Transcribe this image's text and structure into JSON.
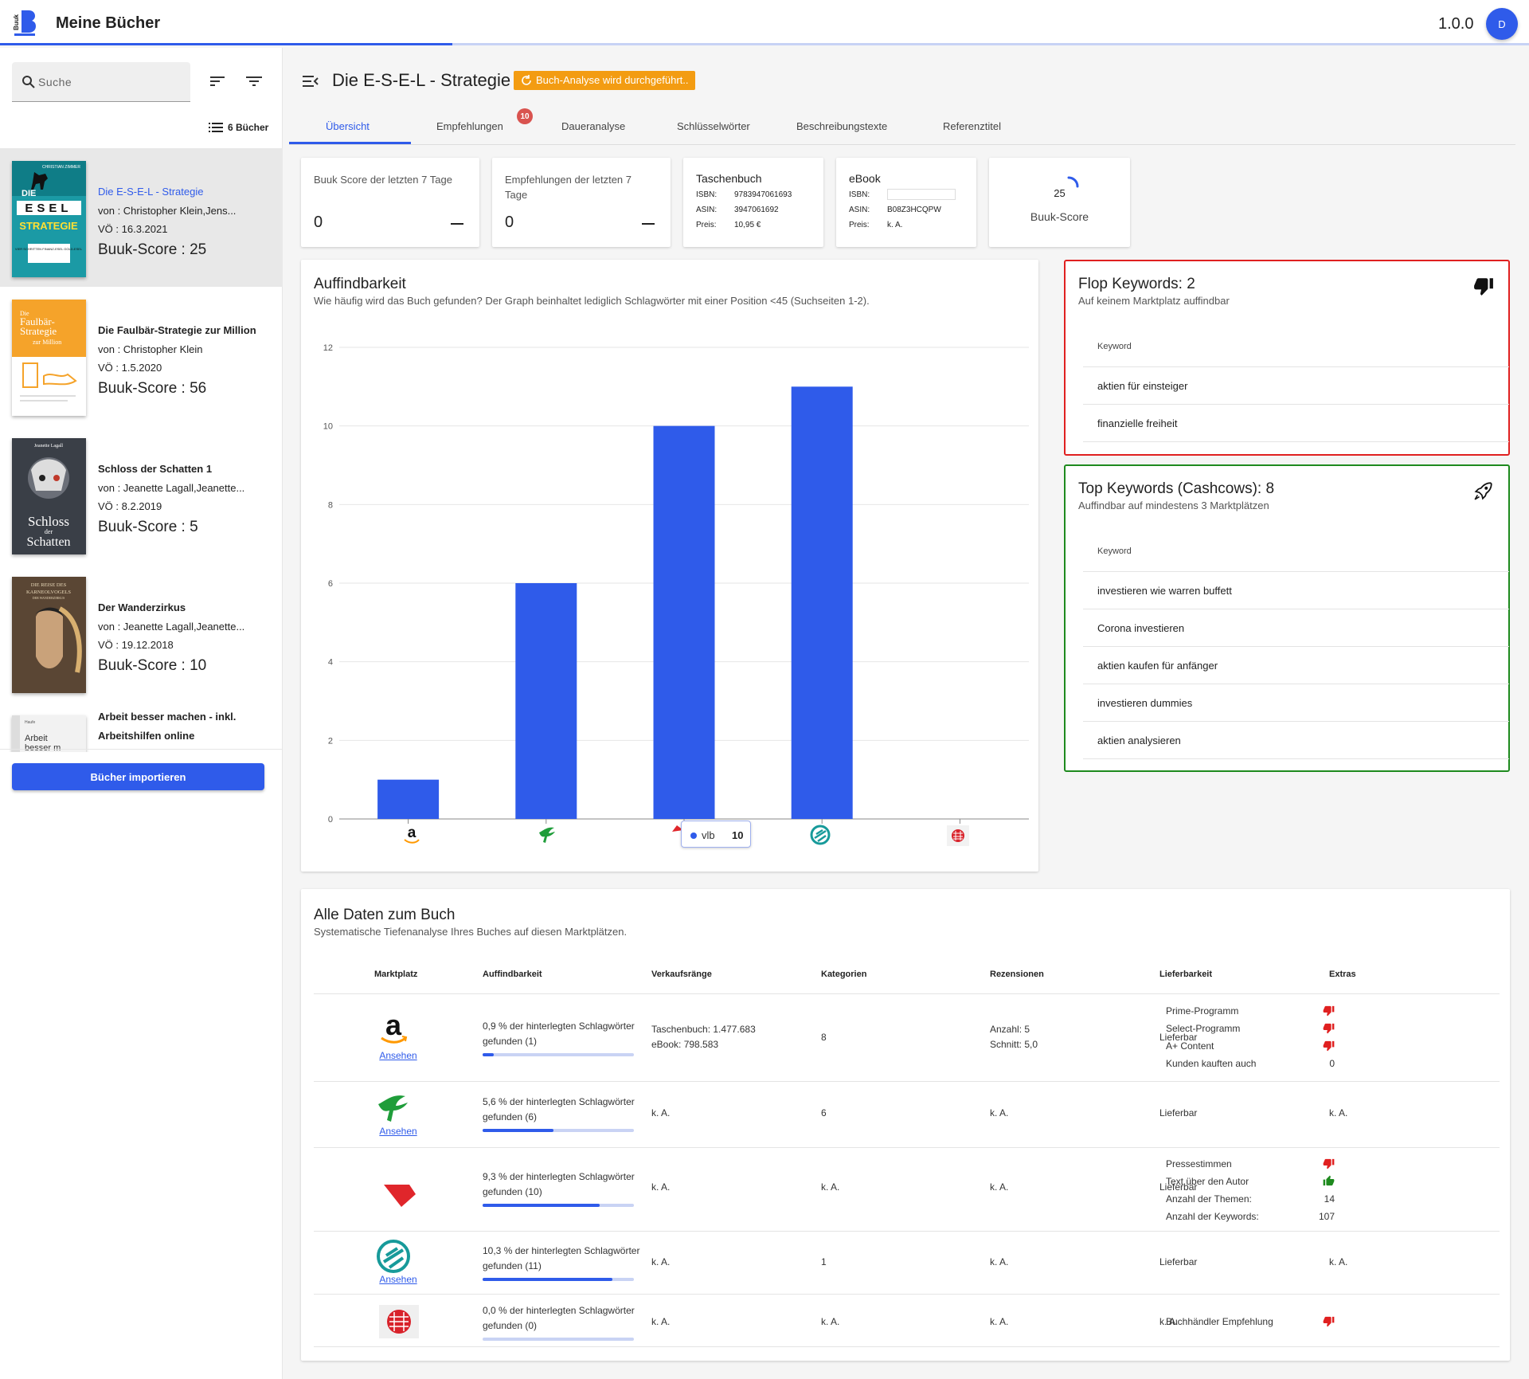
{
  "header": {
    "logo_text": "Buuk",
    "title": "Meine Bücher",
    "version": "1.0.0",
    "avatar_initial": "D"
  },
  "sidebar": {
    "search_placeholder": "Suche",
    "book_count": "6 Bücher",
    "import_label": "Bücher importieren",
    "books": [
      {
        "title": "Die E-S-E-L - Strategie",
        "author": "von : Christopher Klein,Jens...",
        "date": "VÖ : 16.3.2021",
        "score": "Buuk-Score : 25",
        "cover_lines": [
          "CHRISTIAN ZIMMER",
          "DIE",
          "ESEL",
          "STRATEGIE",
          "VIER SCHRITTEN FINANZ-ESEL GOLD-ESEL"
        ]
      },
      {
        "title": "Die Faulbär-Strategie zur Million",
        "author": "von : Christopher Klein",
        "date": "VÖ : 1.5.2020",
        "score": "Buuk-Score : 56",
        "cover_lines": [
          "Die",
          "Faulbär-",
          "Strategie",
          "zur Million"
        ]
      },
      {
        "title": "Schloss der Schatten 1",
        "author": "von : Jeanette Lagall,Jeanette...",
        "date": "VÖ : 8.2.2019",
        "score": "Buuk-Score : 5",
        "cover_lines": [
          "Jeanette Lagall",
          "Schloss",
          "der",
          "Schatten"
        ]
      },
      {
        "title": "Der Wanderzirkus",
        "author": "von : Jeanette Lagall,Jeanette...",
        "date": "VÖ : 19.12.2018",
        "score": "Buuk-Score : 10",
        "cover_lines": [
          "DIE REISE DES",
          "KARNEOLVOGELS",
          "DER WANDERZIRKUS"
        ]
      },
      {
        "title": "Arbeit besser machen - inkl.",
        "author": "Arbeitshilfen online",
        "date": "",
        "score": "",
        "cover_lines": [
          "Haufe",
          "Arbeit",
          "besser m"
        ]
      }
    ]
  },
  "main": {
    "book_title": "Die E-S-E-L - Strategie",
    "analysis_badge": "Buch-Analyse wird durchgeführt..",
    "tabs": [
      {
        "label": "Übersicht"
      },
      {
        "label": "Empfehlungen",
        "badge": "10"
      },
      {
        "label": "Daueranalyse"
      },
      {
        "label": "Schlüsselwörter"
      },
      {
        "label": "Beschreibungstexte"
      },
      {
        "label": "Referenztitel"
      }
    ],
    "stats": {
      "score_label": "Buuk Score der letzten 7 Tage",
      "score_value": "0",
      "reco_label": "Empfehlungen der letzten 7 Tage",
      "reco_value": "0"
    },
    "paperback": {
      "title": "Taschenbuch",
      "isbn_k": "ISBN:",
      "isbn": "9783947061693",
      "asin_k": "ASIN:",
      "asin": "3947061692",
      "price_k": "Preis:",
      "price": "10,95 €"
    },
    "ebook": {
      "title": "eBook",
      "isbn_k": "ISBN:",
      "isbn": "",
      "asin_k": "ASIN:",
      "asin": "B08Z3HCQPW",
      "price_k": "Preis:",
      "price": "k. A."
    },
    "gauge": {
      "value": "25",
      "label": "Buuk-Score",
      "fraction": 0.25
    },
    "chart": {
      "title": "Auffindbarkeit",
      "subtitle": "Wie häufig wird das Buch gefunden? Der Graph beinhaltet lediglich Schlagwörter mit einer Position <45 (Suchseiten 1-2).",
      "tooltip_name": "vlb",
      "tooltip_value": "10"
    },
    "flop": {
      "title": "Flop Keywords: 2",
      "subtitle": "Auf keinem Marktplatz auffindbar",
      "head": "Keyword",
      "items": [
        "aktien für einsteiger",
        "finanzielle freiheit"
      ],
      "color": "#e02020"
    },
    "top": {
      "title": "Top Keywords (Cashcows): 8",
      "subtitle": "Auffindbar auf mindestens 3 Marktplätzen",
      "head": "Keyword",
      "items": [
        "investieren wie warren buffett",
        "Corona investieren",
        "aktien kaufen für anfänger",
        "investieren dummies",
        "aktien analysieren"
      ],
      "color": "#1e8a1e"
    },
    "all": {
      "title": "Alle Daten zum Buch",
      "subtitle": "Systematische Tiefenanalyse Ihres Buches auf diesen Marktplätzen.",
      "headers": [
        "Marktplatz",
        "Auffindbarkeit",
        "Verkaufsränge",
        "Kategorien",
        "Rezensionen",
        "Lieferbarkeit",
        "Extras"
      ],
      "ansehen": "Ansehen",
      "rows": [
        {
          "market": "amazon",
          "find_l1": "0,9 % der hinterlegten Schlagwörter",
          "find_l2": "gefunden (1)",
          "find_pct": 0.9,
          "rank_l1": "Taschenbuch: 1.477.683",
          "rank_l2": "eBook: 798.583",
          "cat": "8",
          "rev_l1": "Anzahl: 5",
          "rev_l2": "Schnitt: 5,0",
          "deliv": "Lieferbar",
          "extras": [
            {
              "k": "Prime-Programm",
              "v": "down"
            },
            {
              "k": "Select-Programm",
              "v": "down"
            },
            {
              "k": "A+ Content",
              "v": "down"
            },
            {
              "k": "Kunden kauften auch",
              "v": "0"
            }
          ]
        },
        {
          "market": "thalia",
          "find_l1": "5,6 % der hinterlegten Schlagwörter",
          "find_l2": "gefunden (6)",
          "find_pct": 5.6,
          "rank_l1": "k. A.",
          "rank_l2": "",
          "cat": "6",
          "rev_l1": "k. A.",
          "rev_l2": "",
          "deliv": "Lieferbar",
          "extras_text": "k. A."
        },
        {
          "market": "vlb",
          "find_l1": "9,3 % der hinterlegten Schlagwörter",
          "find_l2": "gefunden (10)",
          "find_pct": 9.3,
          "rank_l1": "k. A.",
          "rank_l2": "",
          "cat": "k. A.",
          "rev_l1": "k. A.",
          "rev_l2": "",
          "deliv": "Lieferbar",
          "extras": [
            {
              "k": "Pressestimmen",
              "v": "down"
            },
            {
              "k": "Text über den Autor",
              "v": "up"
            },
            {
              "k": "Anzahl der Themen:",
              "v": "14"
            },
            {
              "k": "Anzahl der Keywords:",
              "v": "107"
            }
          ]
        },
        {
          "market": "ebook",
          "find_l1": "10,3 % der hinterlegten Schlagwörter",
          "find_l2": "gefunden (11)",
          "find_pct": 10.3,
          "rank_l1": "k. A.",
          "rank_l2": "",
          "cat": "1",
          "rev_l1": "k. A.",
          "rev_l2": "",
          "deliv": "Lieferbar",
          "extras_text": "k. A."
        },
        {
          "market": "buchhandel",
          "find_l1": "0,0 % der hinterlegten Schlagwörter",
          "find_l2": "gefunden (0)",
          "find_pct": 0.0,
          "rank_l1": "k. A.",
          "rank_l2": "",
          "cat": "k. A.",
          "rev_l1": "k. A.",
          "rev_l2": "",
          "deliv": "k. A.",
          "extras": [
            {
              "k": "Buchhändler Empfehlung",
              "v": "down"
            }
          ]
        }
      ]
    }
  },
  "chart_data": {
    "type": "bar",
    "title": "Auffindbarkeit",
    "categories": [
      "amazon",
      "thalia",
      "vlb",
      "ebook.de",
      "buchhandel"
    ],
    "values": [
      1,
      6,
      10,
      11,
      0
    ],
    "ylim": [
      0,
      12
    ],
    "yticks": [
      "0",
      "2",
      "4",
      "6",
      "8",
      "10",
      "12"
    ],
    "grid": true,
    "color": "#2f5bea"
  }
}
